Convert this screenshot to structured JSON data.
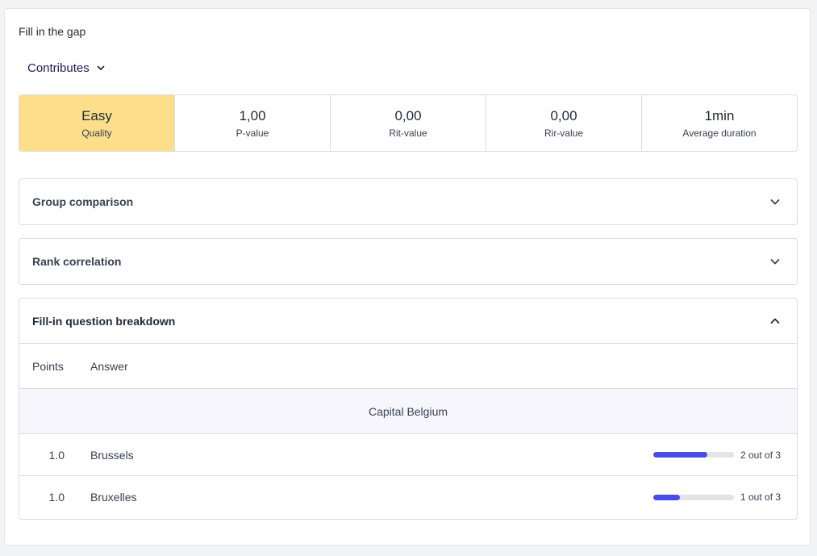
{
  "title": "Fill in the gap",
  "contributes_label": "Contributes",
  "stats": [
    {
      "value": "Easy",
      "label": "Quality"
    },
    {
      "value": "1,00",
      "label": "P-value"
    },
    {
      "value": "0,00",
      "label": "Rit-value"
    },
    {
      "value": "0,00",
      "label": "Rir-value"
    },
    {
      "value": "1min",
      "label": "Average duration"
    }
  ],
  "sections": {
    "group_comparison": "Group comparison",
    "rank_correlation": "Rank correlation",
    "breakdown": "Fill-in question breakdown"
  },
  "breakdown": {
    "headers": {
      "points": "Points",
      "answer": "Answer"
    },
    "group": "Capital Belgium",
    "rows": [
      {
        "points": "1.0",
        "answer": "Brussels",
        "fraction": 0.667,
        "count": "2 out of 3"
      },
      {
        "points": "1.0",
        "answer": "Bruxelles",
        "fraction": 0.333,
        "count": "1 out of 3"
      }
    ]
  },
  "colors": {
    "quality_bg": "#fddf8b",
    "bar_fill": "#4a4ce8",
    "bar_track": "#e2e4e8"
  }
}
